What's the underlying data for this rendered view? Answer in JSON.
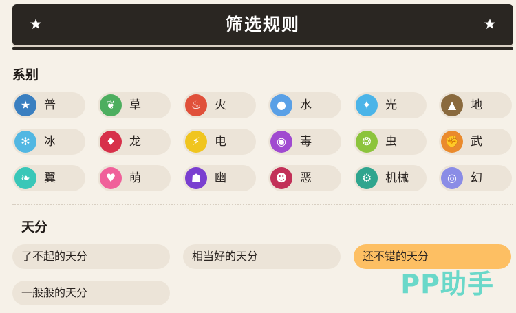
{
  "header": {
    "title": "筛选规则",
    "star_icon": "star-icon"
  },
  "types_section": {
    "title": "系别",
    "items": [
      {
        "label": "普",
        "icon": "normal-icon",
        "glyph": "★",
        "color": "#3a7fc0"
      },
      {
        "label": "草",
        "icon": "grass-icon",
        "glyph": "❦",
        "color": "#4dae5f"
      },
      {
        "label": "火",
        "icon": "fire-icon",
        "glyph": "♨",
        "color": "#e0503a"
      },
      {
        "label": "水",
        "icon": "water-icon",
        "glyph": "●",
        "color": "#5aa0e6"
      },
      {
        "label": "光",
        "icon": "light-icon",
        "glyph": "✦",
        "color": "#4bb4e8"
      },
      {
        "label": "地",
        "icon": "ground-icon",
        "glyph": "▲",
        "color": "#8a6a3e"
      },
      {
        "label": "冰",
        "icon": "ice-icon",
        "glyph": "✻",
        "color": "#52b7e2"
      },
      {
        "label": "龙",
        "icon": "dragon-icon",
        "glyph": "♦",
        "color": "#d7304a"
      },
      {
        "label": "电",
        "icon": "electric-icon",
        "glyph": "⚡",
        "color": "#f0c51f"
      },
      {
        "label": "毒",
        "icon": "poison-icon",
        "glyph": "◉",
        "color": "#a04ad0"
      },
      {
        "label": "虫",
        "icon": "bug-icon",
        "glyph": "❂",
        "color": "#8cc43c"
      },
      {
        "label": "武",
        "icon": "fighting-icon",
        "glyph": "✊",
        "color": "#ea8a2c"
      },
      {
        "label": "翼",
        "icon": "wing-icon",
        "glyph": "❧",
        "color": "#39c7b8"
      },
      {
        "label": "萌",
        "icon": "cute-icon",
        "glyph": "♥",
        "color": "#f0609a"
      },
      {
        "label": "幽",
        "icon": "ghost-icon",
        "glyph": "☗",
        "color": "#7a3fd0"
      },
      {
        "label": "恶",
        "icon": "evil-icon",
        "glyph": "☻",
        "color": "#c23058"
      },
      {
        "label": "机械",
        "icon": "mechanical-icon",
        "glyph": "⚙",
        "color": "#2fa58e"
      },
      {
        "label": "幻",
        "icon": "illusion-icon",
        "glyph": "◎",
        "color": "#8a8ce6"
      }
    ]
  },
  "talent_section": {
    "title": "天分",
    "items": [
      {
        "label": "了不起的天分",
        "active": false
      },
      {
        "label": "相当好的天分",
        "active": false
      },
      {
        "label": "还不错的天分",
        "active": true
      },
      {
        "label": "一般般的天分",
        "active": false
      }
    ]
  },
  "watermark": {
    "text": "PP助手"
  }
}
